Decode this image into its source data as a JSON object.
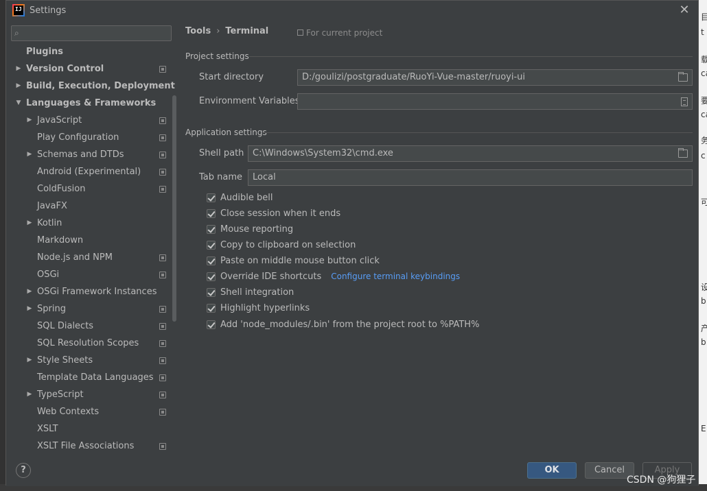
{
  "window": {
    "title": "Settings"
  },
  "search": {
    "placeholder": ""
  },
  "sidebar": {
    "items": [
      {
        "label": "Plugins",
        "level": 0,
        "bold": true,
        "arrow": "",
        "proj": false
      },
      {
        "label": "Version Control",
        "level": 0,
        "bold": true,
        "arrow": "right",
        "proj": true
      },
      {
        "label": "Build, Execution, Deployment",
        "level": 0,
        "bold": true,
        "arrow": "right",
        "proj": false
      },
      {
        "label": "Languages & Frameworks",
        "level": 0,
        "bold": true,
        "arrow": "down",
        "proj": false
      },
      {
        "label": "JavaScript",
        "level": 1,
        "bold": false,
        "arrow": "right",
        "proj": true
      },
      {
        "label": "Play Configuration",
        "level": 1,
        "bold": false,
        "arrow": "",
        "proj": true
      },
      {
        "label": "Schemas and DTDs",
        "level": 1,
        "bold": false,
        "arrow": "right",
        "proj": true
      },
      {
        "label": "Android (Experimental)",
        "level": 1,
        "bold": false,
        "arrow": "",
        "proj": true
      },
      {
        "label": "ColdFusion",
        "level": 1,
        "bold": false,
        "arrow": "",
        "proj": true
      },
      {
        "label": "JavaFX",
        "level": 1,
        "bold": false,
        "arrow": "",
        "proj": false
      },
      {
        "label": "Kotlin",
        "level": 1,
        "bold": false,
        "arrow": "right",
        "proj": false
      },
      {
        "label": "Markdown",
        "level": 1,
        "bold": false,
        "arrow": "",
        "proj": false
      },
      {
        "label": "Node.js and NPM",
        "level": 1,
        "bold": false,
        "arrow": "",
        "proj": true
      },
      {
        "label": "OSGi",
        "level": 1,
        "bold": false,
        "arrow": "",
        "proj": true
      },
      {
        "label": "OSGi Framework Instances",
        "level": 1,
        "bold": false,
        "arrow": "right",
        "proj": false
      },
      {
        "label": "Spring",
        "level": 1,
        "bold": false,
        "arrow": "right",
        "proj": true
      },
      {
        "label": "SQL Dialects",
        "level": 1,
        "bold": false,
        "arrow": "",
        "proj": true
      },
      {
        "label": "SQL Resolution Scopes",
        "level": 1,
        "bold": false,
        "arrow": "",
        "proj": true
      },
      {
        "label": "Style Sheets",
        "level": 1,
        "bold": false,
        "arrow": "right",
        "proj": true
      },
      {
        "label": "Template Data Languages",
        "level": 1,
        "bold": false,
        "arrow": "",
        "proj": true
      },
      {
        "label": "TypeScript",
        "level": 1,
        "bold": false,
        "arrow": "right",
        "proj": true
      },
      {
        "label": "Web Contexts",
        "level": 1,
        "bold": false,
        "arrow": "",
        "proj": true
      },
      {
        "label": "XSLT",
        "level": 1,
        "bold": false,
        "arrow": "",
        "proj": false
      },
      {
        "label": "XSLT File Associations",
        "level": 1,
        "bold": false,
        "arrow": "",
        "proj": true
      }
    ]
  },
  "breadcrumb": {
    "parent": "Tools",
    "separator": "›",
    "current": "Terminal"
  },
  "scope_note": "For current project",
  "project_settings": {
    "title": "Project settings",
    "start_directory_label": "Start directory",
    "start_directory_value": "D:/goulizi/postgraduate/RuoYi-Vue-master/ruoyi-ui",
    "env_vars_label": "Environment Variables",
    "env_vars_value": ""
  },
  "app_settings": {
    "title": "Application settings",
    "shell_path_label": "Shell path",
    "shell_path_value": "C:\\Windows\\System32\\cmd.exe",
    "tab_name_label": "Tab name",
    "tab_name_value": "Local",
    "checkboxes": [
      {
        "label": "Audible bell",
        "checked": true
      },
      {
        "label": "Close session when it ends",
        "checked": true
      },
      {
        "label": "Mouse reporting",
        "checked": true
      },
      {
        "label": "Copy to clipboard on selection",
        "checked": true
      },
      {
        "label": "Paste on middle mouse button click",
        "checked": true
      },
      {
        "label": "Override IDE shortcuts",
        "checked": true,
        "link": "Configure terminal keybindings"
      },
      {
        "label": "Shell integration",
        "checked": true
      },
      {
        "label": "Highlight hyperlinks",
        "checked": true
      },
      {
        "label": "Add 'node_modules/.bin' from the project root to %PATH%",
        "checked": true
      }
    ]
  },
  "footer": {
    "help": "?",
    "ok": "OK",
    "cancel": "Cancel",
    "apply": "Apply"
  },
  "watermark": "CSDN @狗狸子",
  "background_fragments": [
    "目",
    "t",
    "载",
    "ca",
    "要",
    "ca",
    "务",
    "c",
    "可",
    "设",
    "b",
    "产",
    "b",
    "E"
  ]
}
